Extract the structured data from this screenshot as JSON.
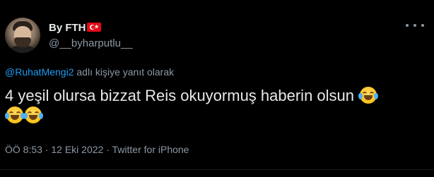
{
  "author": {
    "display_name": "By FTH",
    "handle": "@__byharputlu__",
    "flag_icon": "turkey-flag-icon",
    "avatar_icon": "profile-photo"
  },
  "reply": {
    "mention": "@RuhatMengi2",
    "suffix": " adlı kişiye yanıt olarak"
  },
  "tweet": {
    "text": "4 yeşil olursa bizzat Reis okuyormuş haberin olsun",
    "emoji_icon": "face-with-tears-of-joy-icon"
  },
  "meta": {
    "time": "ÖÖ 8:53",
    "separator": " · ",
    "date": "12 Eki 2022",
    "source": "Twitter for iPhone"
  },
  "colors": {
    "background": "#000000",
    "primary_text": "#e7e9ea",
    "secondary_text": "#8b98a5",
    "accent": "#1d9bf0"
  }
}
